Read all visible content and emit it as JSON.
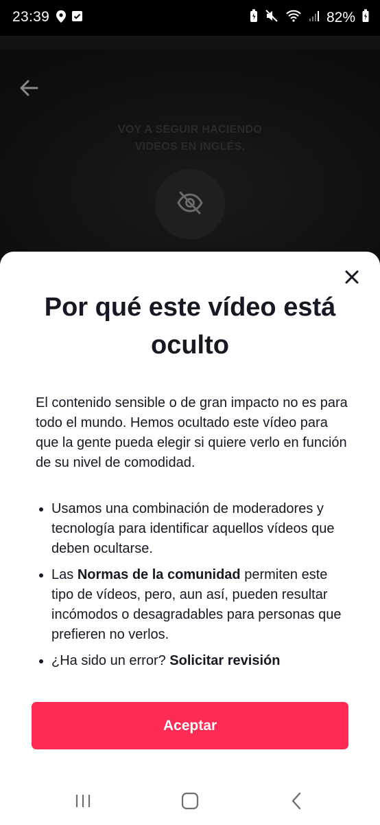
{
  "status_bar": {
    "time": "23:39",
    "battery": "82%"
  },
  "video": {
    "caption": "VOY A SEGUIR HACIENDO VIDEOS EN INGLÉS."
  },
  "sheet": {
    "title": "Por qué este vídeo está oculto",
    "intro": "El contenido sensible o de gran impacto no es para todo el mundo. Hemos ocultado este vídeo para que la gente pueda elegir si quiere verlo en función de su nivel de comodidad.",
    "bullets": {
      "b1": "Usamos una combinación de moderadores y tecnología para identificar aquellos vídeos que deben ocultarse.",
      "b2_prefix": "Las ",
      "b2_link": "Normas de la comunidad",
      "b2_suffix": " permiten este tipo de vídeos, pero, aun así, pueden resultar incómodos o desagradables para personas que prefieren no verlos.",
      "b3_prefix": "¿Ha sido un error? ",
      "b3_link": "Solicitar revisión"
    },
    "accept_label": "Aceptar"
  },
  "colors": {
    "accent": "#fe2c55",
    "text": "#161823",
    "sheet_bg": "#ffffff"
  },
  "icons": {
    "back": "arrow-left-icon",
    "hidden": "eye-off-icon",
    "close": "close-icon",
    "recents": "recent-apps-icon",
    "home": "home-icon",
    "nav_back": "back-chevron-icon"
  }
}
